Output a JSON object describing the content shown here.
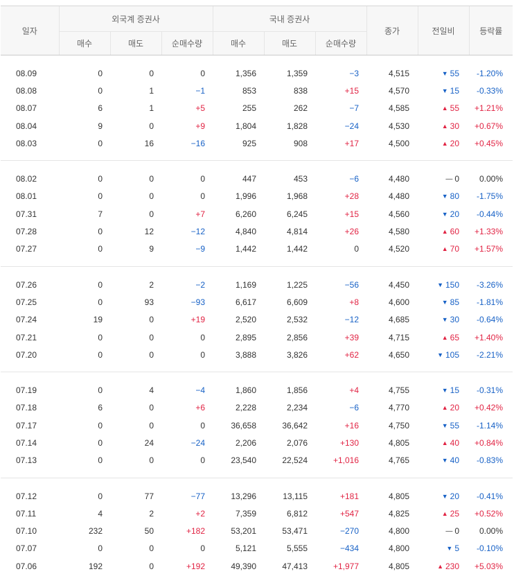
{
  "colors": {
    "up": "#e12343",
    "down": "#1761c6",
    "header_bg": "#f7f7f7"
  },
  "header": {
    "date": "일자",
    "foreign": "외국계 증권사",
    "domestic": "국내 증권사",
    "close": "종가",
    "diff": "전일비",
    "rate": "등락률",
    "buy": "매수",
    "sell": "매도",
    "net": "순매수량"
  },
  "groups": [
    [
      {
        "date": "08.09",
        "fb": "0",
        "fs": "0",
        "fn": "0",
        "fnd": "flat",
        "db": "1,356",
        "ds": "1,359",
        "dn": "−3",
        "dnd": "down",
        "close": "4,515",
        "diff": "55",
        "dd": "down",
        "rate": "-1.20%",
        "rd": "down"
      },
      {
        "date": "08.08",
        "fb": "0",
        "fs": "1",
        "fn": "−1",
        "fnd": "down",
        "db": "853",
        "ds": "838",
        "dn": "+15",
        "dnd": "up",
        "close": "4,570",
        "diff": "15",
        "dd": "down",
        "rate": "-0.33%",
        "rd": "down"
      },
      {
        "date": "08.07",
        "fb": "6",
        "fs": "1",
        "fn": "+5",
        "fnd": "up",
        "db": "255",
        "ds": "262",
        "dn": "−7",
        "dnd": "down",
        "close": "4,585",
        "diff": "55",
        "dd": "up",
        "rate": "+1.21%",
        "rd": "up"
      },
      {
        "date": "08.04",
        "fb": "9",
        "fs": "0",
        "fn": "+9",
        "fnd": "up",
        "db": "1,804",
        "ds": "1,828",
        "dn": "−24",
        "dnd": "down",
        "close": "4,530",
        "diff": "30",
        "dd": "up",
        "rate": "+0.67%",
        "rd": "up"
      },
      {
        "date": "08.03",
        "fb": "0",
        "fs": "16",
        "fn": "−16",
        "fnd": "down",
        "db": "925",
        "ds": "908",
        "dn": "+17",
        "dnd": "up",
        "close": "4,500",
        "diff": "20",
        "dd": "up",
        "rate": "+0.45%",
        "rd": "up"
      }
    ],
    [
      {
        "date": "08.02",
        "fb": "0",
        "fs": "0",
        "fn": "0",
        "fnd": "flat",
        "db": "447",
        "ds": "453",
        "dn": "−6",
        "dnd": "down",
        "close": "4,480",
        "diff": "0",
        "dd": "flat",
        "rate": "0.00%",
        "rd": "flat"
      },
      {
        "date": "08.01",
        "fb": "0",
        "fs": "0",
        "fn": "0",
        "fnd": "flat",
        "db": "1,996",
        "ds": "1,968",
        "dn": "+28",
        "dnd": "up",
        "close": "4,480",
        "diff": "80",
        "dd": "down",
        "rate": "-1.75%",
        "rd": "down"
      },
      {
        "date": "07.31",
        "fb": "7",
        "fs": "0",
        "fn": "+7",
        "fnd": "up",
        "db": "6,260",
        "ds": "6,245",
        "dn": "+15",
        "dnd": "up",
        "close": "4,560",
        "diff": "20",
        "dd": "down",
        "rate": "-0.44%",
        "rd": "down"
      },
      {
        "date": "07.28",
        "fb": "0",
        "fs": "12",
        "fn": "−12",
        "fnd": "down",
        "db": "4,840",
        "ds": "4,814",
        "dn": "+26",
        "dnd": "up",
        "close": "4,580",
        "diff": "60",
        "dd": "up",
        "rate": "+1.33%",
        "rd": "up"
      },
      {
        "date": "07.27",
        "fb": "0",
        "fs": "9",
        "fn": "−9",
        "fnd": "down",
        "db": "1,442",
        "ds": "1,442",
        "dn": "0",
        "dnd": "flat",
        "close": "4,520",
        "diff": "70",
        "dd": "up",
        "rate": "+1.57%",
        "rd": "up"
      }
    ],
    [
      {
        "date": "07.26",
        "fb": "0",
        "fs": "2",
        "fn": "−2",
        "fnd": "down",
        "db": "1,169",
        "ds": "1,225",
        "dn": "−56",
        "dnd": "down",
        "close": "4,450",
        "diff": "150",
        "dd": "down",
        "rate": "-3.26%",
        "rd": "down"
      },
      {
        "date": "07.25",
        "fb": "0",
        "fs": "93",
        "fn": "−93",
        "fnd": "down",
        "db": "6,617",
        "ds": "6,609",
        "dn": "+8",
        "dnd": "up",
        "close": "4,600",
        "diff": "85",
        "dd": "down",
        "rate": "-1.81%",
        "rd": "down"
      },
      {
        "date": "07.24",
        "fb": "19",
        "fs": "0",
        "fn": "+19",
        "fnd": "up",
        "db": "2,520",
        "ds": "2,532",
        "dn": "−12",
        "dnd": "down",
        "close": "4,685",
        "diff": "30",
        "dd": "down",
        "rate": "-0.64%",
        "rd": "down"
      },
      {
        "date": "07.21",
        "fb": "0",
        "fs": "0",
        "fn": "0",
        "fnd": "flat",
        "db": "2,895",
        "ds": "2,856",
        "dn": "+39",
        "dnd": "up",
        "close": "4,715",
        "diff": "65",
        "dd": "up",
        "rate": "+1.40%",
        "rd": "up"
      },
      {
        "date": "07.20",
        "fb": "0",
        "fs": "0",
        "fn": "0",
        "fnd": "flat",
        "db": "3,888",
        "ds": "3,826",
        "dn": "+62",
        "dnd": "up",
        "close": "4,650",
        "diff": "105",
        "dd": "down",
        "rate": "-2.21%",
        "rd": "down"
      }
    ],
    [
      {
        "date": "07.19",
        "fb": "0",
        "fs": "4",
        "fn": "−4",
        "fnd": "down",
        "db": "1,860",
        "ds": "1,856",
        "dn": "+4",
        "dnd": "up",
        "close": "4,755",
        "diff": "15",
        "dd": "down",
        "rate": "-0.31%",
        "rd": "down"
      },
      {
        "date": "07.18",
        "fb": "6",
        "fs": "0",
        "fn": "+6",
        "fnd": "up",
        "db": "2,228",
        "ds": "2,234",
        "dn": "−6",
        "dnd": "down",
        "close": "4,770",
        "diff": "20",
        "dd": "up",
        "rate": "+0.42%",
        "rd": "up"
      },
      {
        "date": "07.17",
        "fb": "0",
        "fs": "0",
        "fn": "0",
        "fnd": "flat",
        "db": "36,658",
        "ds": "36,642",
        "dn": "+16",
        "dnd": "up",
        "close": "4,750",
        "diff": "55",
        "dd": "down",
        "rate": "-1.14%",
        "rd": "down"
      },
      {
        "date": "07.14",
        "fb": "0",
        "fs": "24",
        "fn": "−24",
        "fnd": "down",
        "db": "2,206",
        "ds": "2,076",
        "dn": "+130",
        "dnd": "up",
        "close": "4,805",
        "diff": "40",
        "dd": "up",
        "rate": "+0.84%",
        "rd": "up"
      },
      {
        "date": "07.13",
        "fb": "0",
        "fs": "0",
        "fn": "0",
        "fnd": "flat",
        "db": "23,540",
        "ds": "22,524",
        "dn": "+1,016",
        "dnd": "up",
        "close": "4,765",
        "diff": "40",
        "dd": "down",
        "rate": "-0.83%",
        "rd": "down"
      }
    ],
    [
      {
        "date": "07.12",
        "fb": "0",
        "fs": "77",
        "fn": "−77",
        "fnd": "down",
        "db": "13,296",
        "ds": "13,115",
        "dn": "+181",
        "dnd": "up",
        "close": "4,805",
        "diff": "20",
        "dd": "down",
        "rate": "-0.41%",
        "rd": "down"
      },
      {
        "date": "07.11",
        "fb": "4",
        "fs": "2",
        "fn": "+2",
        "fnd": "up",
        "db": "7,359",
        "ds": "6,812",
        "dn": "+547",
        "dnd": "up",
        "close": "4,825",
        "diff": "25",
        "dd": "up",
        "rate": "+0.52%",
        "rd": "up"
      },
      {
        "date": "07.10",
        "fb": "232",
        "fs": "50",
        "fn": "+182",
        "fnd": "up",
        "db": "53,201",
        "ds": "53,471",
        "dn": "−270",
        "dnd": "down",
        "close": "4,800",
        "diff": "0",
        "dd": "flat",
        "rate": "0.00%",
        "rd": "flat"
      },
      {
        "date": "07.07",
        "fb": "0",
        "fs": "0",
        "fn": "0",
        "fnd": "flat",
        "db": "5,121",
        "ds": "5,555",
        "dn": "−434",
        "dnd": "down",
        "close": "4,800",
        "diff": "5",
        "dd": "down",
        "rate": "-0.10%",
        "rd": "down"
      },
      {
        "date": "07.06",
        "fb": "192",
        "fs": "0",
        "fn": "+192",
        "fnd": "up",
        "db": "49,390",
        "ds": "47,413",
        "dn": "+1,977",
        "dnd": "up",
        "close": "4,805",
        "diff": "230",
        "dd": "up",
        "rate": "+5.03%",
        "rd": "up"
      }
    ]
  ]
}
